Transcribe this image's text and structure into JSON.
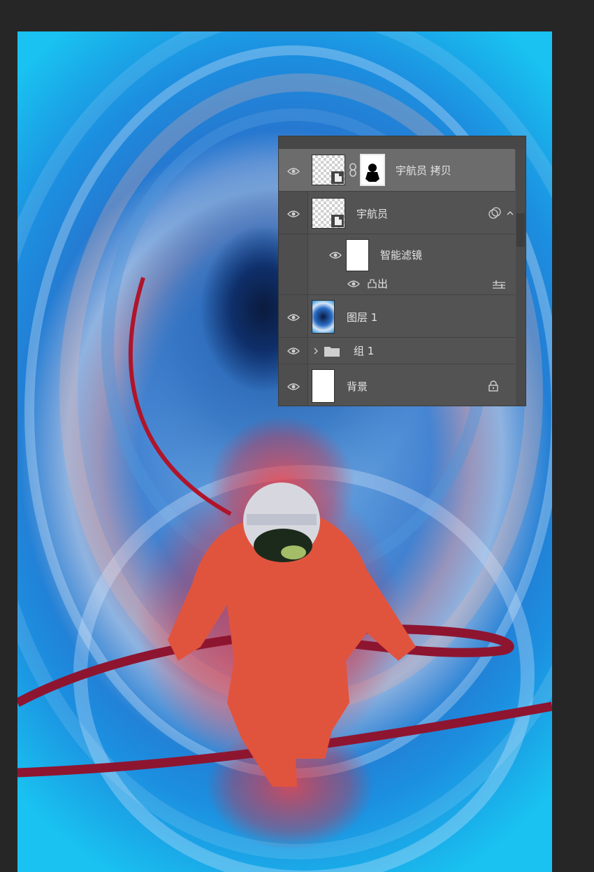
{
  "layers_panel": {
    "layers": [
      {
        "name": "宇航员 拷贝",
        "selected": true,
        "has_mask": true,
        "linked": true
      },
      {
        "name": "宇航员",
        "smart_object": true
      },
      {
        "name": "智能滤镜",
        "type": "smart-filter-mask"
      },
      {
        "name": "凸出",
        "type": "filter"
      },
      {
        "name": "图层 1"
      },
      {
        "name": "组 1",
        "type": "group",
        "collapsed": true
      },
      {
        "name": "背景",
        "locked": true
      }
    ]
  },
  "colors": {
    "panel_bg": "#535353",
    "selected_row": "#6c6c6c",
    "app_bg": "#262626",
    "astronaut_red": "#e0543e",
    "cable_red": "#b0142a"
  },
  "icons": [
    "eye-icon",
    "chain-link-icon",
    "smart-object-icon",
    "folder-icon",
    "chevron-right-icon",
    "lock-icon",
    "filter-options-icon",
    "filter-effects-icon",
    "collapse-arrow-icon"
  ]
}
